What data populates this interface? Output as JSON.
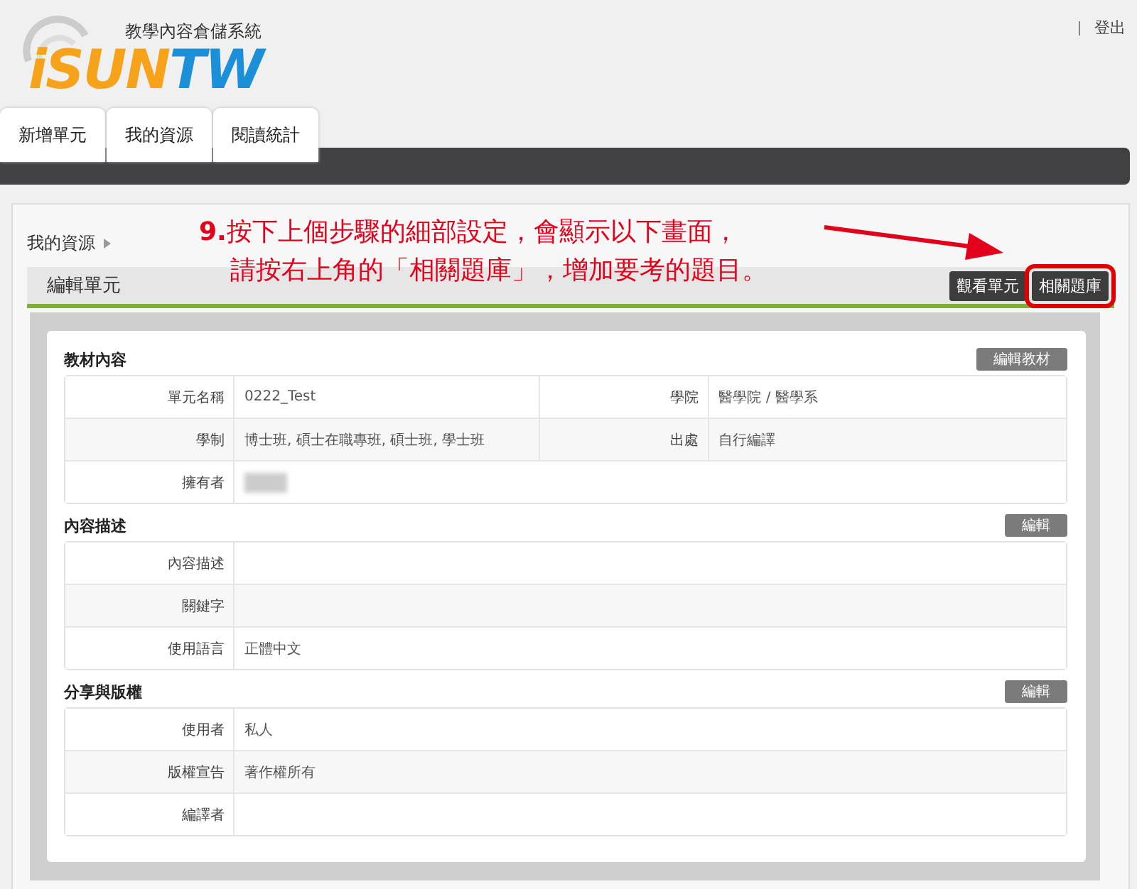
{
  "header": {
    "system_name": "教學內容倉儲系統",
    "logo_parts": [
      {
        "text": "iSUN",
        "color": "#f7a21b"
      },
      {
        "text": "TW",
        "color": "#1b8fd8"
      }
    ],
    "logout": "登出"
  },
  "tabs": [
    {
      "label": "新增單元",
      "selected": false
    },
    {
      "label": "我的資源",
      "selected": false
    },
    {
      "label": "閱讀統計",
      "selected": false
    }
  ],
  "breadcrumb": "我的資源",
  "annotation": {
    "step": "9.",
    "lines": [
      "按下上個步驟的細部設定，會顯示以下畫面，",
      "請按右上角的「相關題庫」，增加要考的題目。"
    ]
  },
  "page_title": "編輯單元",
  "header_buttons": [
    {
      "label": "觀看單元",
      "highlighted": false
    },
    {
      "label": "相關題庫",
      "highlighted": true
    }
  ],
  "sections": [
    {
      "title": "教材內容",
      "button": "編輯教材",
      "rows": [
        {
          "cells": [
            {
              "label": "單元名稱",
              "value": "0222_Test"
            },
            {
              "label": "學院",
              "value": "醫學院 / 醫學系"
            }
          ]
        },
        {
          "cells": [
            {
              "label": "學制",
              "value": "博士班, 碩士在職專班, 碩士班, 學士班"
            },
            {
              "label": "出處",
              "value": "自行編譯"
            }
          ]
        },
        {
          "cells": [
            {
              "label": "擁有者",
              "redacted": true
            }
          ]
        }
      ]
    },
    {
      "title": "內容描述",
      "button": "編輯",
      "rows": [
        {
          "cells": [
            {
              "label": "內容描述"
            }
          ]
        },
        {
          "cells": [
            {
              "label": "關鍵字"
            }
          ]
        },
        {
          "cells": [
            {
              "label": "使用語言",
              "value": "正體中文"
            }
          ]
        }
      ]
    },
    {
      "title": "分享與版權",
      "button": "編輯",
      "rows": [
        {
          "cells": [
            {
              "label": "使用者",
              "value": "私人"
            }
          ]
        },
        {
          "cells": [
            {
              "label": "版權宣告",
              "value": "著作權所有"
            }
          ]
        },
        {
          "cells": [
            {
              "label": "編譯者"
            }
          ]
        }
      ]
    }
  ]
}
